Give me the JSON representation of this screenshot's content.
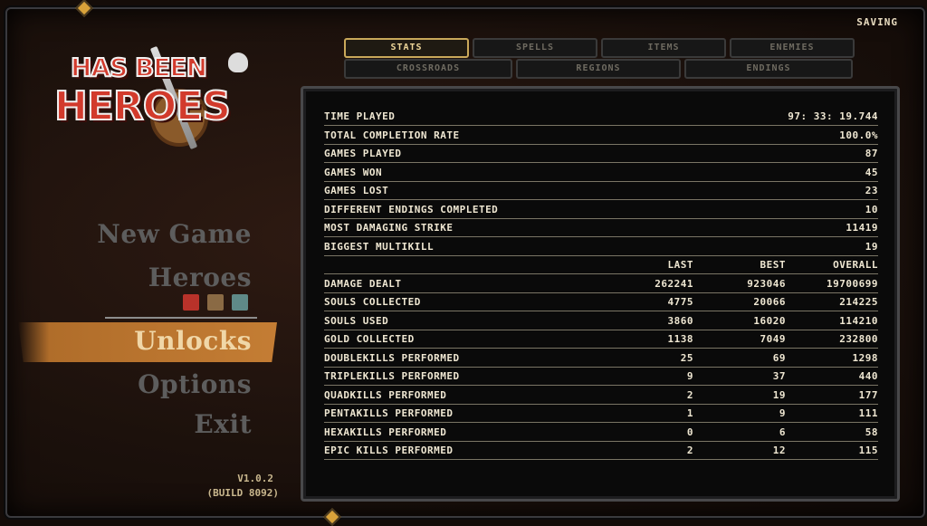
{
  "status": {
    "saving": "SAVING"
  },
  "logo": {
    "line1": "HAS BEEN",
    "line2": "HEROES"
  },
  "menu": {
    "new_game": "New Game",
    "heroes": "Heroes",
    "unlocks": "Unlocks",
    "options": "Options",
    "exit": "Exit",
    "active": "Unlocks",
    "hero_icons": [
      "red",
      "brown",
      "teal"
    ]
  },
  "version": {
    "number": "V1.0.2",
    "build": "(BUILD 8092)"
  },
  "tabs": {
    "row1": [
      "STATS",
      "SPELLS",
      "ITEMS",
      "ENEMIES"
    ],
    "row2": [
      "CROSSROADS",
      "REGIONS",
      "ENDINGS"
    ],
    "active": "STATS"
  },
  "stats": {
    "general": [
      {
        "label": "TIME PLAYED",
        "value": "97: 33: 19.744"
      },
      {
        "label": "TOTAL COMPLETION RATE",
        "value": "100.0%"
      },
      {
        "label": "GAMES PLAYED",
        "value": "87"
      },
      {
        "label": "GAMES WON",
        "value": "45"
      },
      {
        "label": "GAMES LOST",
        "value": "23"
      },
      {
        "label": "DIFFERENT ENDINGS COMPLETED",
        "value": "10"
      },
      {
        "label": "MOST DAMAGING STRIKE",
        "value": "11419"
      },
      {
        "label": "BIGGEST MULTIKILL",
        "value": "19"
      }
    ],
    "columns": [
      "LAST",
      "BEST",
      "OVERALL"
    ],
    "detailed": [
      {
        "label": "DAMAGE DEALT",
        "last": "262241",
        "best": "923046",
        "overall": "19700699"
      },
      {
        "label": "SOULS COLLECTED",
        "last": "4775",
        "best": "20066",
        "overall": "214225"
      },
      {
        "label": "SOULS USED",
        "last": "3860",
        "best": "16020",
        "overall": "114210"
      },
      {
        "label": "GOLD COLLECTED",
        "last": "1138",
        "best": "7049",
        "overall": "232800"
      },
      {
        "label": "DOUBLEKILLS PERFORMED",
        "last": "25",
        "best": "69",
        "overall": "1298"
      },
      {
        "label": "TRIPLEKILLS PERFORMED",
        "last": "9",
        "best": "37",
        "overall": "440"
      },
      {
        "label": "QUADKILLS PERFORMED",
        "last": "2",
        "best": "19",
        "overall": "177"
      },
      {
        "label": "PENTAKILLS PERFORMED",
        "last": "1",
        "best": "9",
        "overall": "111"
      },
      {
        "label": "HEXAKILLS PERFORMED",
        "last": "0",
        "best": "6",
        "overall": "58"
      },
      {
        "label": "EPIC KILLS PERFORMED",
        "last": "2",
        "best": "12",
        "overall": "115"
      }
    ]
  },
  "colors": {
    "accent": "#c47d34",
    "text": "#efe7d2",
    "menu_inactive": "#5d5d5d",
    "tab_active_border": "#c9a85a"
  }
}
